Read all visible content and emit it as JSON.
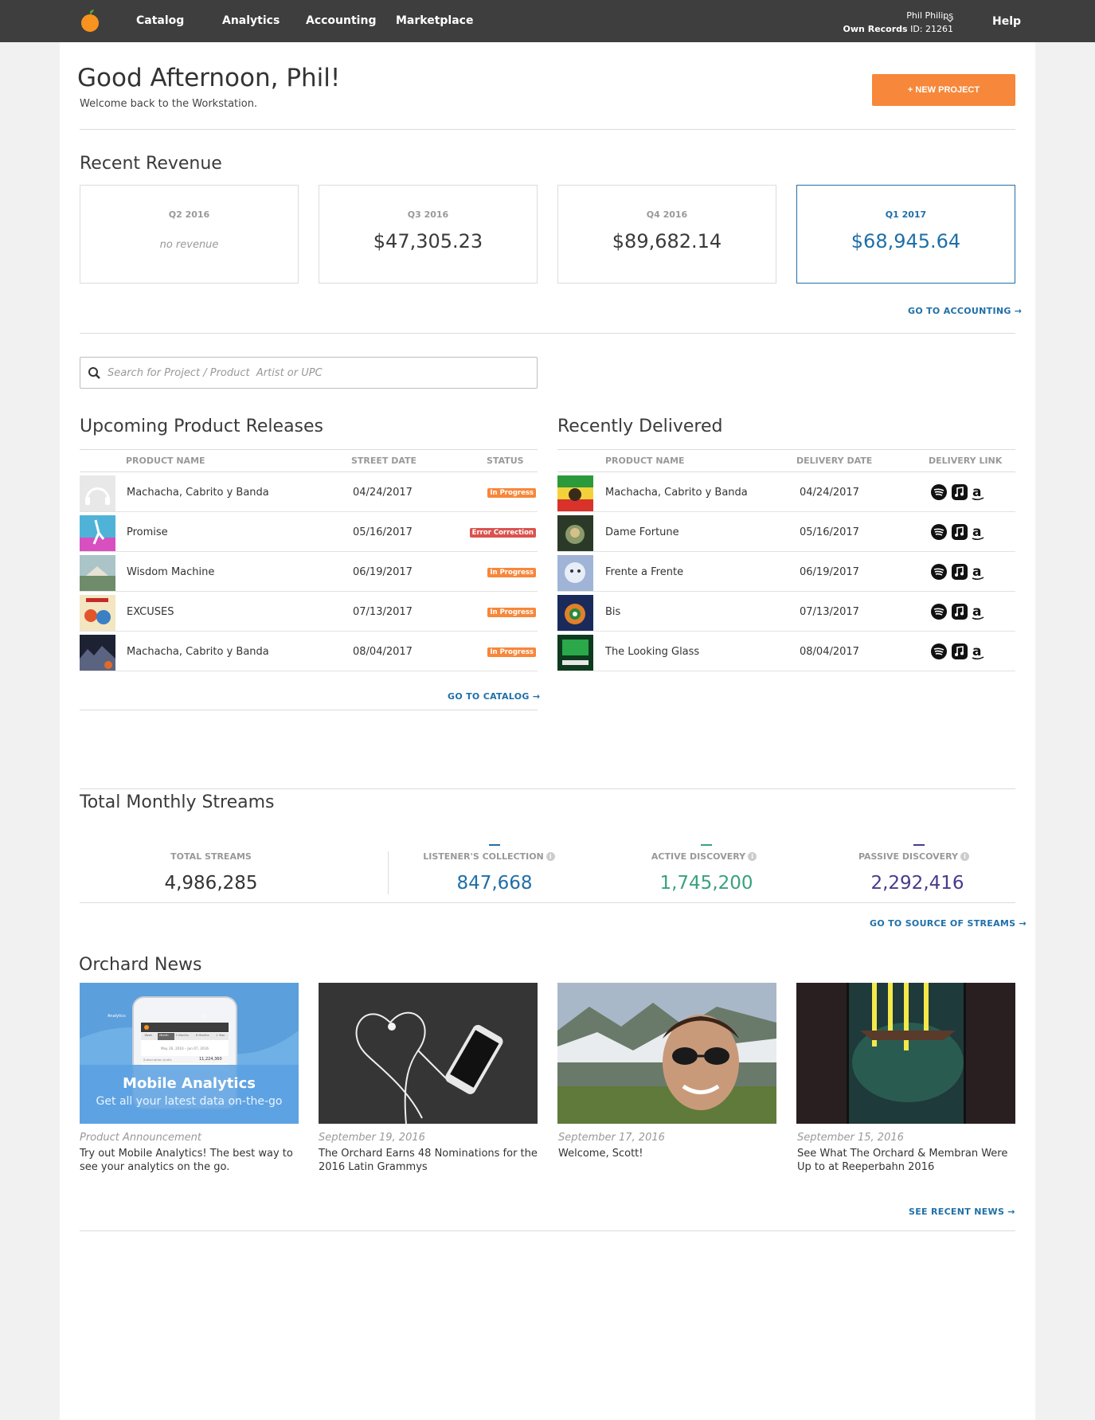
{
  "nav": {
    "items": [
      "Catalog",
      "Analytics",
      "Accounting",
      "Marketplace"
    ],
    "user_name": "Phil Philips",
    "account_label": "Own Records",
    "account_id": "ID: 21261",
    "help": "Help"
  },
  "header": {
    "greeting": "Good Afternoon, Phil!",
    "welcome": "Welcome back to the Workstation.",
    "new_project": "+ NEW PROJECT"
  },
  "revenue": {
    "title": "Recent Revenue",
    "cards": [
      {
        "quarter": "Q2 2016",
        "value": "no revenue"
      },
      {
        "quarter": "Q3 2016",
        "value": "$47,305.23"
      },
      {
        "quarter": "Q4 2016",
        "value": "$89,682.14"
      },
      {
        "quarter": "Q1 2017",
        "value": "$68,945.64"
      }
    ],
    "link": "GO TO ACCOUNTING →"
  },
  "search": {
    "placeholder": "Search for Project / Product  Artist or UPC"
  },
  "upcoming": {
    "title": "Upcoming Product Releases",
    "headers": [
      "PRODUCT NAME",
      "STREET DATE",
      "STATUS"
    ],
    "rows": [
      {
        "name": "Machacha, Cabrito y Banda",
        "date": "04/24/2017",
        "status": "In Progress"
      },
      {
        "name": "Promise",
        "date": "05/16/2017",
        "status": "Error Correction"
      },
      {
        "name": "Wisdom Machine",
        "date": "06/19/2017",
        "status": "In Progress"
      },
      {
        "name": "EXCUSES",
        "date": "07/13/2017",
        "status": "In Progress"
      },
      {
        "name": "Machacha, Cabrito y Banda",
        "date": "08/04/2017",
        "status": "In Progress"
      }
    ],
    "link": "GO TO CATALOG →"
  },
  "delivered": {
    "title": "Recently Delivered",
    "headers": [
      "PRODUCT NAME",
      "DELIVERY DATE",
      "DELIVERY LINK"
    ],
    "rows": [
      {
        "name": "Machacha, Cabrito y Banda",
        "date": "04/24/2017"
      },
      {
        "name": "Dame Fortune",
        "date": "05/16/2017"
      },
      {
        "name": "Frente a Frente",
        "date": "06/19/2017"
      },
      {
        "name": "Bis",
        "date": "07/13/2017"
      },
      {
        "name": "The Looking Glass",
        "date": "08/04/2017"
      }
    ],
    "delivery_icons": [
      "spotify-icon",
      "apple-music-icon",
      "amazon-icon"
    ]
  },
  "streams": {
    "title": "Total Monthly Streams",
    "stats": [
      {
        "label": "TOTAL STREAMS",
        "value": "4,986,285",
        "color": "#333333"
      },
      {
        "label": "LISTENER'S COLLECTION",
        "value": "847,668",
        "color": "#1f6fa8"
      },
      {
        "label": "ACTIVE DISCOVERY",
        "value": "1,745,200",
        "color": "#3aa17e"
      },
      {
        "label": "PASSIVE DISCOVERY",
        "value": "2,292,416",
        "color": "#4a3a8c"
      }
    ],
    "link": "GO TO SOURCE OF STREAMS →"
  },
  "news": {
    "title": "Orchard News",
    "items": [
      {
        "date": "Product Announcement",
        "text": "Try out Mobile Analytics! The best way to see your analytics on the go.",
        "banner_title": "Mobile Analytics",
        "banner_sub": "Get all your latest data on-the-go",
        "app_label": "Analytics",
        "app_tabs": [
          "Week",
          "Month",
          "3 Months",
          "6 Months",
          "1 Year"
        ],
        "app_dates": "May 26, 2016 – Jun 07, 2016",
        "app_row": "Subscription Audio",
        "app_value": "11,224,360"
      },
      {
        "date": "September 19, 2016",
        "text": "The Orchard Earns 48 Nominations for the 2016 Latin Grammys"
      },
      {
        "date": "September 17, 2016",
        "text": "Welcome, Scott!"
      },
      {
        "date": "September 15, 2016",
        "text": "See What The Orchard & Membran Were Up to at Reeperbahn 2016"
      }
    ],
    "link": "SEE RECENT NEWS →"
  },
  "colors": {
    "accent": "#f7873a",
    "link": "#1f6fa8",
    "nav_bg": "#3e3e3e"
  }
}
